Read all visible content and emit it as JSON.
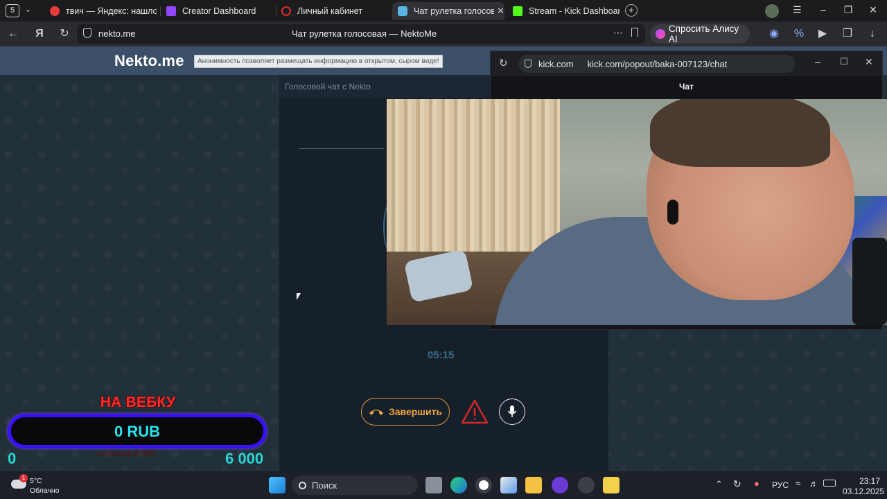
{
  "browser": {
    "tab_count_badge": "5",
    "tabs": [
      {
        "label": "твич — Яндекс: нашлось",
        "color": "#e83b3b"
      },
      {
        "label": "Creator Dashboard",
        "color": "#9147ff"
      },
      {
        "label": "Личный кабинет",
        "color": "#e02a2a"
      },
      {
        "label": "Чат рулетка голосовая",
        "color": "#58b4e0"
      },
      {
        "label": "Stream - Kick Dashboard",
        "color": "#53fc18"
      }
    ],
    "url": "nekto.me",
    "page_title": "Чат рулетка голосовая — NektoMe",
    "alice_label": "Спросить Алису AI"
  },
  "nekto": {
    "logo": "Nekto.me",
    "tagline": "Анонимность позволяет размещать информацию в открытом, сыром виде!",
    "panel_title": "Голосовой чат с Nekto",
    "timer": "05:15",
    "end_button": "Завершить"
  },
  "popup": {
    "domain": "kick.com",
    "url": "kick.com/popout/baka-007123/chat",
    "title": "Чат"
  },
  "overlay": {
    "label": "НА ВЕБКУ",
    "value": "0 RUB",
    "min": "0",
    "max": "6 000",
    "sub": "осталось 6 000"
  },
  "taskbar": {
    "weather_temp": "5°C",
    "weather_desc": "Облачно",
    "weather_badge": "1",
    "search_label": "Поиск",
    "lang": "РУС",
    "time": "23:17",
    "date": "03.12.2025"
  },
  "colors": {
    "accent_orange": "#f0a542",
    "overlay_blue": "#3b10ff",
    "overlay_cyan": "#27e4f0",
    "overlay_red": "#ff2a2a"
  }
}
